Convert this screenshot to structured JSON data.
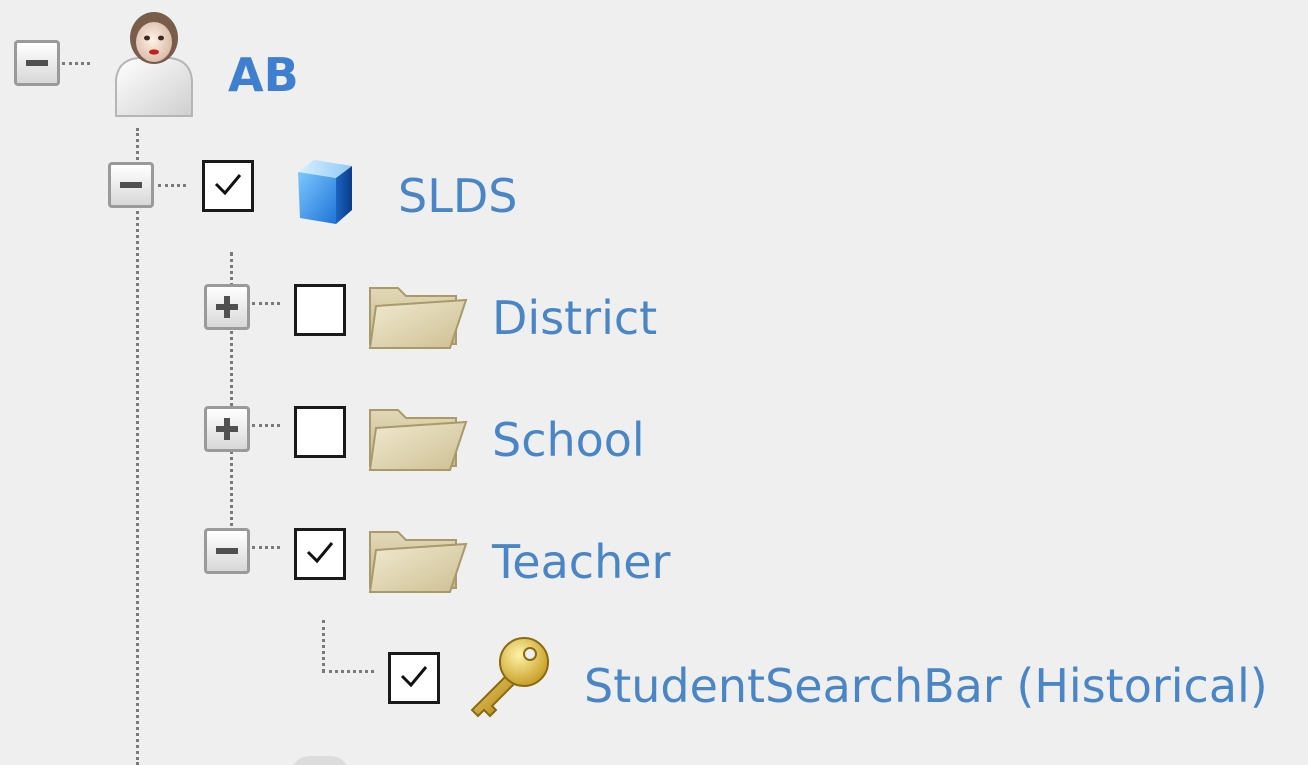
{
  "tree": {
    "root": {
      "label": "AB",
      "icon": "user-icon",
      "expanded": true
    },
    "nodes": [
      {
        "id": "slds",
        "label": "SLDS",
        "icon": "cube-icon",
        "checked": true,
        "expanded": true
      },
      {
        "id": "district",
        "label": "District",
        "icon": "folder-icon",
        "checked": false,
        "expanded": false
      },
      {
        "id": "school",
        "label": "School",
        "icon": "folder-icon",
        "checked": false,
        "expanded": false
      },
      {
        "id": "teacher",
        "label": "Teacher",
        "icon": "folder-icon",
        "checked": true,
        "expanded": true
      },
      {
        "id": "student-search-bar",
        "label": "StudentSearchBar (Historical)",
        "icon": "key-icon",
        "checked": true
      }
    ]
  },
  "colors": {
    "background": "#efefef",
    "label": "#4a86c6",
    "root_label": "#3f7fcf"
  }
}
